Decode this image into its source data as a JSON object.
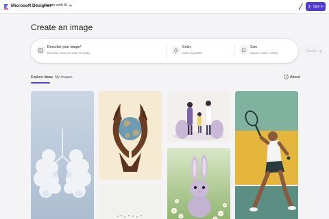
{
  "header": {
    "brand": "Microsoft Designer",
    "create_menu_label": "Create with AI",
    "sign_in_label": "Sign in"
  },
  "page": {
    "title": "Create an image"
  },
  "prompt": {
    "describe_label": "Describe your image*",
    "describe_placeholder": "Describe what you want to create",
    "color_label": "Color",
    "color_value": "Select a palette",
    "size_label": "Size",
    "size_value": "Square (1024 x 1024)",
    "create_label": "Create"
  },
  "tabs": [
    {
      "label": "Explore ideas",
      "active": true
    },
    {
      "label": "My images",
      "active": false
    }
  ],
  "about_label": "About",
  "gallery": [
    {
      "name": "cloud-lungs"
    },
    {
      "name": "hands-holding-earth"
    },
    {
      "name": "doctors-family"
    },
    {
      "name": "tennis-player"
    },
    {
      "name": "minimal-landscape"
    },
    {
      "name": "bunny-in-flowers"
    }
  ],
  "colors": {
    "accent": "#4f3bd6",
    "background": "#f4f4f6"
  },
  "icons": {
    "logo": "designer-logo-icon",
    "brush": "paintbrush-icon",
    "person": "person-icon",
    "image": "image-icon",
    "palette": "droplet-icon",
    "size": "aspect-ratio-icon",
    "arrow": "arrow-right-icon",
    "info": "info-icon"
  }
}
